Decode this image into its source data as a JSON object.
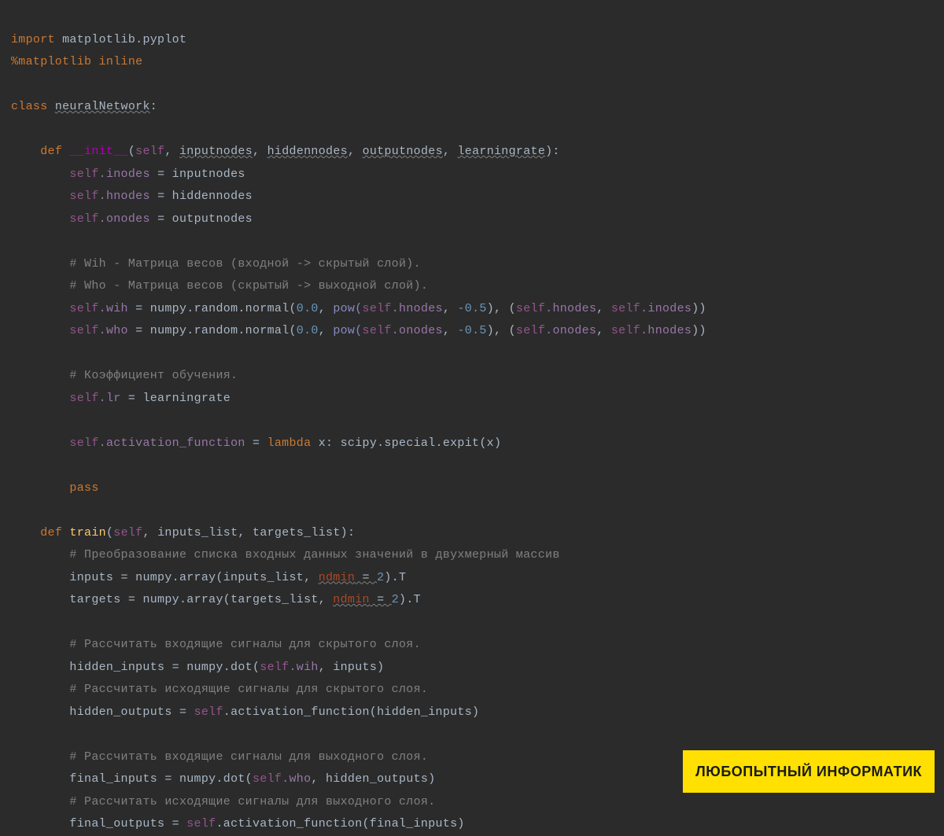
{
  "lines": {
    "l1_import": "import",
    "l1_mod": "matplotlib.pyplot",
    "l2_magic": "%matplotlib inline",
    "l4_class": "class",
    "l4_name": "neuralNetwork",
    "l4_colon": ":",
    "l6_def": "def",
    "l6_name": "__init__",
    "l6_open": "(",
    "l6_self": "self",
    "l6_c1": ", ",
    "l6_p1": "inputnodes",
    "l6_c2": ", ",
    "l6_p2": "hiddennodes",
    "l6_c3": ", ",
    "l6_p3": "outputnodes",
    "l6_c4": ", ",
    "l6_p4": "learningrate",
    "l6_close": "):",
    "l7_self": "self",
    "l7_attr": ".inodes",
    "l7_eq": " = ",
    "l7_val": "inputnodes",
    "l8_self": "self",
    "l8_attr": ".hnodes",
    "l8_eq": " = ",
    "l8_val": "hiddennodes",
    "l9_self": "self",
    "l9_attr": ".onodes",
    "l9_eq": " = ",
    "l9_val": "outputnodes",
    "l11_cmt": "# Wih - Матрица весов (входной -> скрытый слой).",
    "l12_cmt": "# Who - Матрица весов (скрытый -> выходной слой).",
    "l13_self": "self",
    "l13_attr": ".wih",
    "l13_eq": " = ",
    "l13_call": "numpy.random.normal(",
    "l13_n1": "0.0",
    "l13_c1": ", ",
    "l13_pow": "pow(",
    "l13_self2": "self",
    "l13_attr2": ".hnodes",
    "l13_c2": ", ",
    "l13_n2": "-0.5",
    "l13_c3": "), (",
    "l13_self3": "self",
    "l13_attr3": ".hnodes",
    "l13_c4": ", ",
    "l13_self4": "self",
    "l13_attr4": ".inodes",
    "l13_end": "))",
    "l14_self": "self",
    "l14_attr": ".who",
    "l14_eq": " = ",
    "l14_call": "numpy.random.normal(",
    "l14_n1": "0.0",
    "l14_c1": ", ",
    "l14_pow": "pow(",
    "l14_self2": "self",
    "l14_attr2": ".onodes",
    "l14_c2": ", ",
    "l14_n2": "-0.5",
    "l14_c3": "), (",
    "l14_self3": "self",
    "l14_attr3": ".onodes",
    "l14_c4": ", ",
    "l14_self4": "self",
    "l14_attr4": ".hnodes",
    "l14_end": "))",
    "l16_cmt": "# Коэффициент обучения.",
    "l17_self": "self",
    "l17_attr": ".lr",
    "l17_eq": " = ",
    "l17_val": "learningrate",
    "l19_self": "self",
    "l19_attr": ".activation_function",
    "l19_eq": " = ",
    "l19_lambda": "lambda",
    "l19_x": " x: ",
    "l19_call": "scipy.special.expit(x)",
    "l21_pass": "pass",
    "l23_def": "def",
    "l23_name": "train",
    "l23_open": "(",
    "l23_self": "self",
    "l23_c1": ", ",
    "l23_p1": "inputs_list",
    "l23_c2": ", ",
    "l23_p2": "targets_list",
    "l23_close": "):",
    "l24_cmt": "# Преобразование списка входных данных значений в двухмерный массив",
    "l25_var": "inputs",
    "l25_eq": " = ",
    "l25_call": "numpy.array(inputs_list, ",
    "l25_kw": "ndmin",
    "l25_kweq": " = ",
    "l25_kwv": "2",
    "l25_end": ").T",
    "l26_var": "targets",
    "l26_eq": " = ",
    "l26_call": "numpy.array(targets_list, ",
    "l26_kw": "ndmin",
    "l26_kweq": " = ",
    "l26_kwv": "2",
    "l26_end": ").T",
    "l28_cmt": "# Рассчитать входящие сигналы для скрытого слоя.",
    "l29_var": "hidden_inputs",
    "l29_eq": " = ",
    "l29_call": "numpy.dot(",
    "l29_self": "self",
    "l29_attr": ".wih",
    "l29_c1": ", inputs)",
    "l30_cmt": "# Рассчитать исходящие сигналы для скрытого слоя.",
    "l31_var": "hidden_outputs",
    "l31_eq": " = ",
    "l31_self": "self",
    "l31_attr": ".activation_function(hidden_inputs)",
    "l33_cmt": "# Рассчитать входящие сигналы для выходного слоя.",
    "l34_var": "final_inputs",
    "l34_eq": " = ",
    "l34_call": "numpy.dot(",
    "l34_self": "self",
    "l34_attr": ".who",
    "l34_c1": ", hidden_outputs)",
    "l35_cmt": "# Рассчитать исходящие сигналы для выходного слоя.",
    "l36_var": "final_outputs",
    "l36_eq": " = ",
    "l36_self": "self",
    "l36_attr": ".activation_function(final_inputs)"
  },
  "watermark": "ЛЮБОПЫТНЫЙ ИНФОРМАТИК"
}
